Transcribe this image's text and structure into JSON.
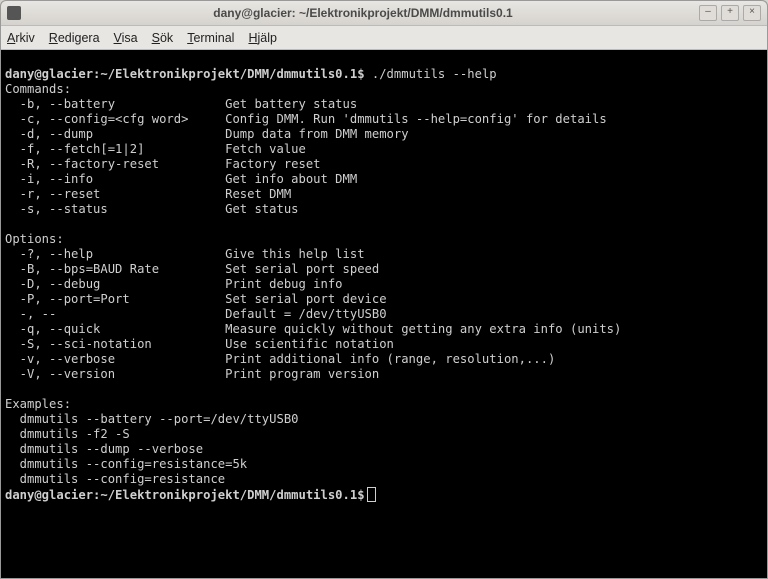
{
  "window": {
    "title": "dany@glacier: ~/Elektronikprojekt/DMM/dmmutils0.1"
  },
  "window_buttons": {
    "minimize": "–",
    "maximize": "+",
    "close": "×"
  },
  "menu": {
    "arkiv": "Arkiv",
    "redigera": "Redigera",
    "visa": "Visa",
    "sok": "Sök",
    "terminal": "Terminal",
    "hjalp": "Hjälp"
  },
  "prompt": {
    "line1_prefix": "dany@glacier:~/Elektronikprojekt/DMM/dmmutils0.1$",
    "cmd": " ./dmmutils --help",
    "line_end_prefix": "dany@glacier:~/Elektronikprojekt/DMM/dmmutils0.1$"
  },
  "out": {
    "commands_hdr": "Commands:",
    "c_b": "  -b, --battery               Get battery status",
    "c_c": "  -c, --config=<cfg word>     Config DMM. Run 'dmmutils --help=config' for details",
    "c_d": "  -d, --dump                  Dump data from DMM memory",
    "c_f": "  -f, --fetch[=1|2]           Fetch value",
    "c_R": "  -R, --factory-reset         Factory reset",
    "c_i": "  -i, --info                  Get info about DMM",
    "c_r": "  -r, --reset                 Reset DMM",
    "c_s": "  -s, --status                Get status",
    "blank1": " ",
    "options_hdr": "Options:",
    "o_h": "  -?, --help                  Give this help list",
    "o_B": "  -B, --bps=BAUD Rate         Set serial port speed",
    "o_D": "  -D, --debug                 Print debug info",
    "o_P": "  -P, --port=Port             Set serial port device",
    "o_def": "  -, --                       Default = /dev/ttyUSB0",
    "o_q": "  -q, --quick                 Measure quickly without getting any extra info (units)",
    "o_S": "  -S, --sci-notation          Use scientific notation",
    "o_v": "  -v, --verbose               Print additional info (range, resolution,...)",
    "o_V": "  -V, --version               Print program version",
    "blank2": " ",
    "examples_hdr": "Examples:",
    "ex1": "  dmmutils --battery --port=/dev/ttyUSB0",
    "ex2": "  dmmutils -f2 -S",
    "ex3": "  dmmutils --dump --verbose",
    "ex4": "  dmmutils --config=resistance=5k",
    "ex5": "  dmmutils --config=resistance"
  }
}
